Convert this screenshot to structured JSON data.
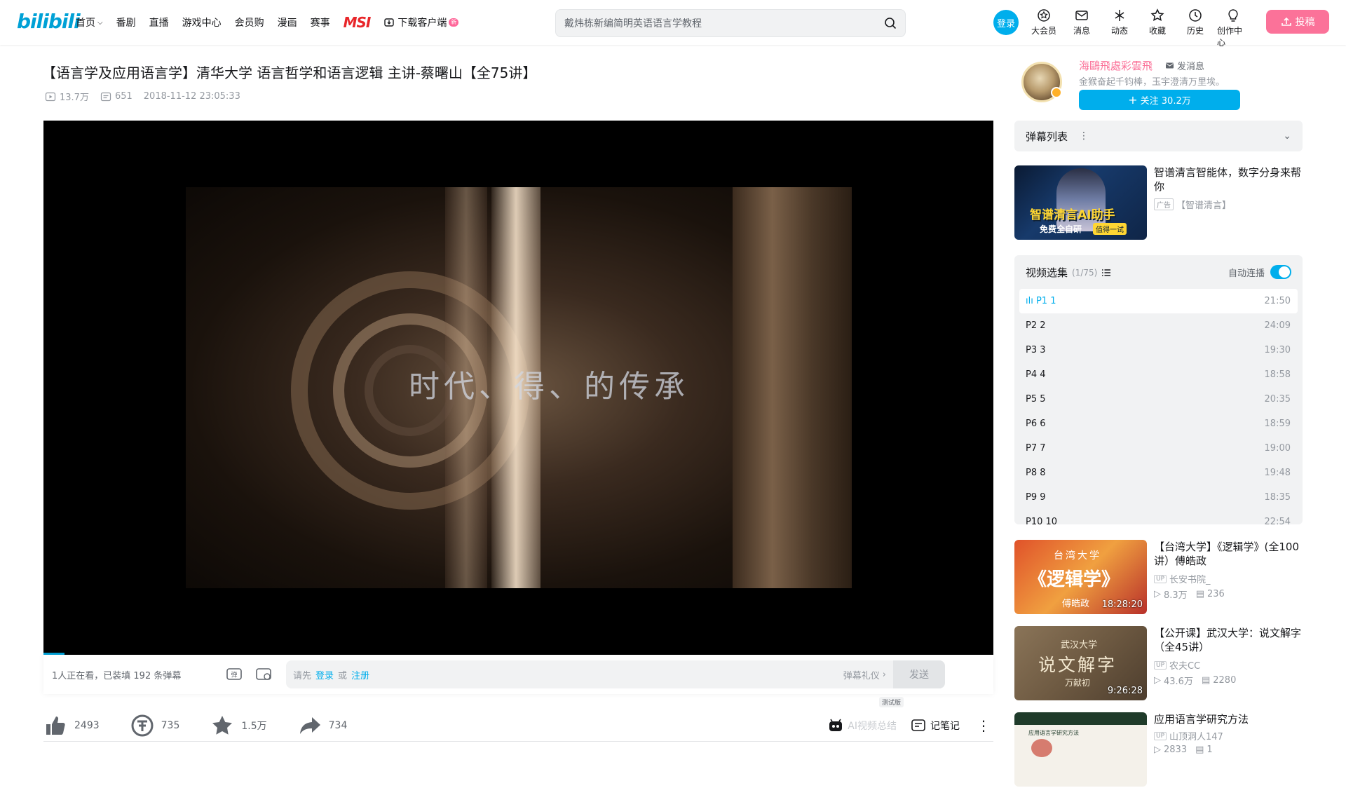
{
  "header": {
    "logo": "bilibili",
    "nav": [
      "首页",
      "番剧",
      "直播",
      "游戏中心",
      "会员购",
      "漫画",
      "赛事"
    ],
    "msi": "MSI",
    "download": "下载客户端",
    "download_badge": "新",
    "search_placeholder": "戴炜栋新编简明英语语言学教程",
    "login": "登录",
    "icons": [
      {
        "label": "大会员",
        "icon": "vip-icon"
      },
      {
        "label": "消息",
        "icon": "message-icon"
      },
      {
        "label": "动态",
        "icon": "dynamic-icon"
      },
      {
        "label": "收藏",
        "icon": "favorite-icon"
      },
      {
        "label": "历史",
        "icon": "history-icon"
      },
      {
        "label": "创作中心",
        "icon": "creator-icon"
      }
    ],
    "upload": "投稿",
    "accent": "#00aeec",
    "pink": "#fb7299"
  },
  "video": {
    "title": "【语言学及应用语言学】清华大学 语言哲学和语言逻辑 主讲-蔡曙山【全75讲】",
    "views": "13.7万",
    "danmaku_count": "651",
    "date": "2018-11-12 23:05:33",
    "caption": "时代、得、的传承"
  },
  "danmaku_bar": {
    "info": "1人正在看，已装填 192 条弹幕",
    "prompt_prefix": "请先",
    "login": "登录",
    "or": "或",
    "register": "注册",
    "etiquette": "弹幕礼仪",
    "send": "发送"
  },
  "toolbar": {
    "like": "2493",
    "coin": "735",
    "favorite": "1.5万",
    "share": "734",
    "test_badge": "测试版",
    "ai_summary": "AI视频总结",
    "notes": "记笔记"
  },
  "uploader": {
    "name": "海鷗飛處彩雲飛",
    "send_message": "发消息",
    "sign": "金猴奋起千钧棒，玉宇澄清万里埃。",
    "follow": "关注 30.2万"
  },
  "danmaku_list": {
    "title": "弹幕列表"
  },
  "ad": {
    "title": "智谱清言智能体，数字分身来帮你",
    "tag": "广告",
    "source": "【智谱清言】",
    "thumb_text": "智谱清言AI助手",
    "thumb_sub": "免费全自研",
    "thumb_badge": "值得一试"
  },
  "episodes": {
    "title": "视频选集",
    "count": "(1/75)",
    "autoplay": "自动连播",
    "items": [
      {
        "label": "P1  1",
        "duration": "21:50"
      },
      {
        "label": "P2  2",
        "duration": "24:09"
      },
      {
        "label": "P3  3",
        "duration": "19:30"
      },
      {
        "label": "P4  4",
        "duration": "18:58"
      },
      {
        "label": "P5  5",
        "duration": "20:35"
      },
      {
        "label": "P6  6",
        "duration": "18:59"
      },
      {
        "label": "P7  7",
        "duration": "19:00"
      },
      {
        "label": "P8  8",
        "duration": "19:48"
      },
      {
        "label": "P9  9",
        "duration": "18:35"
      },
      {
        "label": "P10  10",
        "duration": "22:54"
      }
    ]
  },
  "recommendations": [
    {
      "title": "【台湾大学】《逻辑学》(全100讲）傅皓政",
      "up": "长安书院_",
      "views": "8.3万",
      "danmaku": "236",
      "duration": "18:28:20",
      "thumb_line1": "台湾大学",
      "thumb_line2": "《逻辑学》",
      "thumb_line3": "傅皓政"
    },
    {
      "title": "【公开课】武汉大学：说文解字（全45讲）",
      "up": "农夫CC",
      "views": "43.6万",
      "danmaku": "2280",
      "duration": "9:26:28",
      "thumb_line1": "武汉大学",
      "thumb_line2": "说文解字",
      "thumb_line3": "万献初"
    },
    {
      "title": "应用语言学研究方法",
      "up": "山顶洞人147",
      "views": "2833",
      "danmaku": "1",
      "duration": "",
      "thumb_line1": "应用语言学研究方法",
      "thumb_line2": "",
      "thumb_line3": ""
    }
  ]
}
